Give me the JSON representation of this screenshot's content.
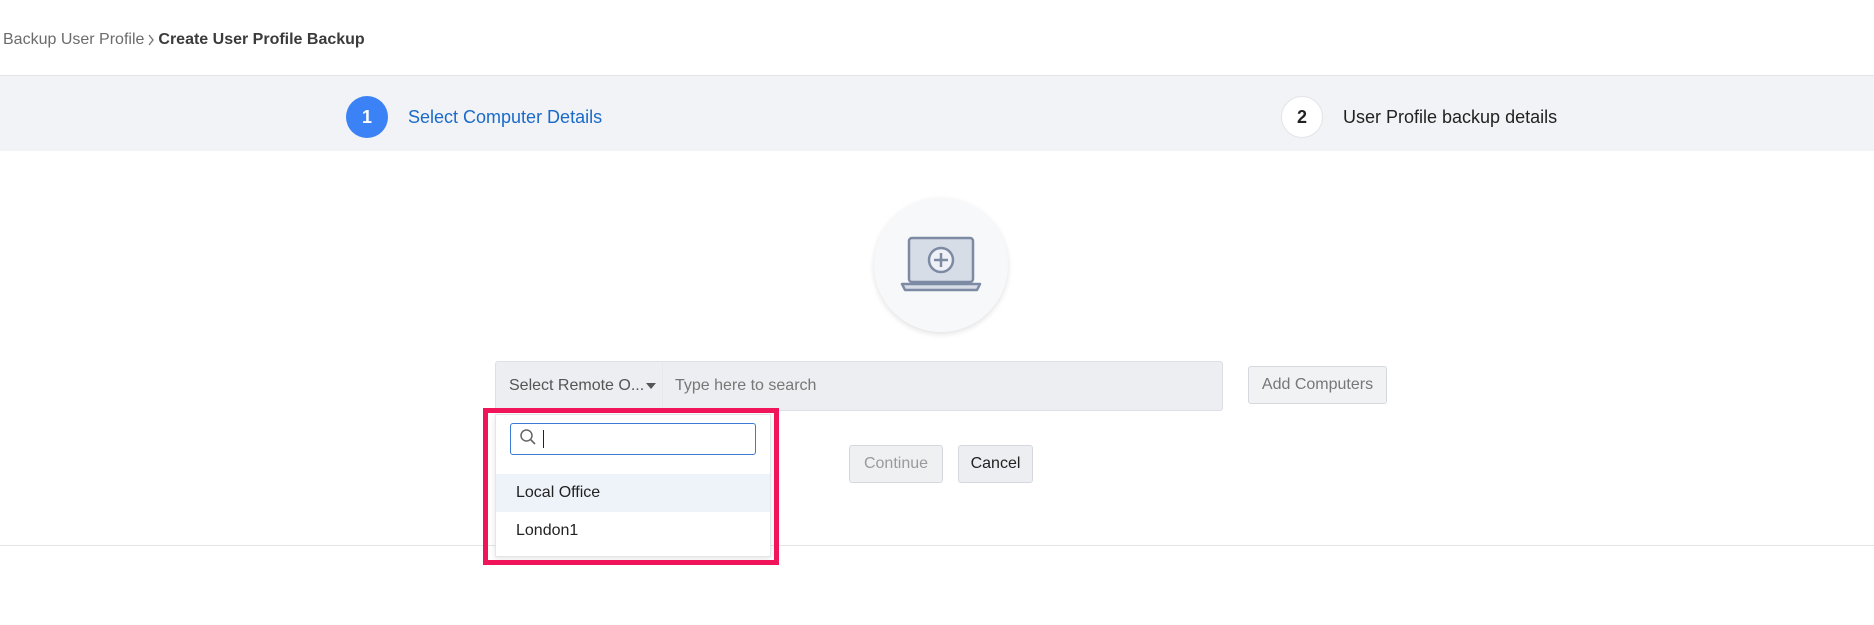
{
  "breadcrumb": {
    "parent": "Backup User Profile",
    "current": "Create User Profile Backup"
  },
  "stepper": {
    "steps": [
      {
        "number": "1",
        "label": "Select Computer Details",
        "active": true
      },
      {
        "number": "2",
        "label": "User Profile backup details",
        "active": false
      }
    ]
  },
  "icons": {
    "hero": "laptop-plus-icon",
    "breadcrumb_sep": "chevron-right-icon",
    "search": "search-icon",
    "select_caret": "caret-down-icon"
  },
  "search_row": {
    "remote_select_value": "Select Remote O...",
    "search_placeholder": "Type here to search",
    "add_computers_label": "Add Computers"
  },
  "actions": {
    "continue_label": "Continue",
    "cancel_label": "Cancel"
  },
  "dropdown": {
    "search_value": "",
    "options": [
      "Local Office",
      "London1"
    ]
  },
  "colors": {
    "accent": "#3b82f6",
    "active_step_text": "#1a6ac9",
    "highlight_border": "#f0145a",
    "stepper_bg": "#f2f3f6"
  }
}
